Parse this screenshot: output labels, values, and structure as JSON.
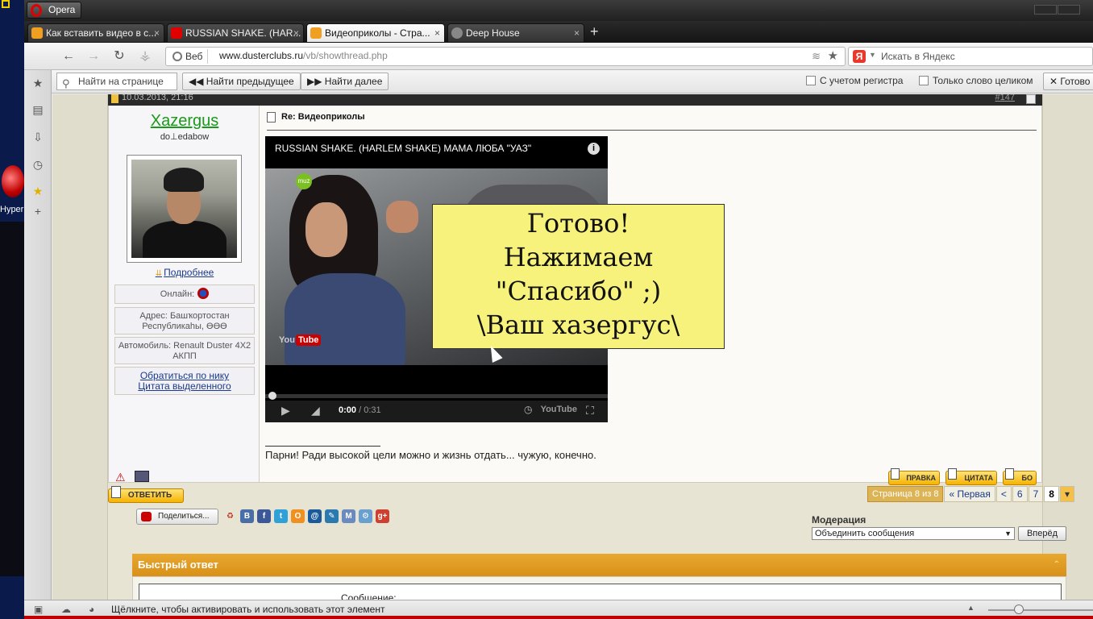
{
  "desktop": {
    "icon_label": "Hyper"
  },
  "browser": {
    "menu_button": "Opera",
    "tabs": [
      {
        "label": "Как вставить видео в с...",
        "active": false,
        "icon_color": "#f0a020"
      },
      {
        "label": "RUSSIAN SHAKE. (HAR...",
        "active": false,
        "icon_color": "#e00000"
      },
      {
        "label": "Видеоприколы - Стра...",
        "active": true,
        "icon_color": "#f0a020"
      },
      {
        "label": "Deep House",
        "active": false,
        "icon_color": "#888888"
      }
    ],
    "tab_close": "×",
    "new_tab": "+",
    "address": {
      "badge": "Веб",
      "domain": "www.dusterclubs.ru",
      "path": "/vb/showthread.php"
    },
    "search": {
      "logo": "Я",
      "placeholder": "Искать в Яндекс"
    },
    "find": {
      "input_placeholder": "Найти на странице",
      "prev": "Найти предыдущее",
      "next": "Найти далее",
      "case_label": "С учетом регистра",
      "whole_label": "Только слово целиком",
      "done": "Готово"
    },
    "status_text": "Щёлкните, чтобы активировать и использовать этот элемент",
    "zoom_level": 0.27
  },
  "post": {
    "date": "10.03.2013, 21:16",
    "number": "#147",
    "username": "Xazergus",
    "usertitle": "do⊥edabow",
    "more_link": "Подробнее",
    "online_label": "Онлайн:",
    "address": "Адрес: Башҡортостан Республикаһы, ӨӨӨ",
    "car": "Автомобиль: Renault Duster 4X2 АКПП",
    "link_nick": "Обратиться по нику",
    "link_quote": "Цитата выделенного",
    "title": "Re: Видеоприколы",
    "video": {
      "title": "RUSSIAN SHAKE. (HARLEM SHAKE) МАМА ЛЮБА \"УАЗ\"",
      "info_icon": "i",
      "time_current": "0:00",
      "time_total": " / 0:31",
      "youtube_mark": "You",
      "youtube_tube": "Tube",
      "muztv": "muz",
      "progress": 0.0
    },
    "signature": "Парни! Ради высокой цели можно и жизнь отдать... чужую, конечно.",
    "btn_edit": "ПРАВКА",
    "btn_quote": "ЦИТАТА",
    "btn_multi": "БО"
  },
  "thread": {
    "reply_button": "ОТВЕТИТЬ",
    "pager": {
      "label": "Страница 8 из 8",
      "first": "« Первая",
      "prev": "<",
      "p6": "6",
      "p7": "7",
      "p8": "8",
      "more": "▾"
    },
    "share_button": "Поделиться...",
    "social": [
      {
        "letter": "В",
        "color": "#4a6ea8"
      },
      {
        "letter": "f",
        "color": "#3b5998"
      },
      {
        "letter": "t",
        "color": "#2fa0d8"
      },
      {
        "letter": "О",
        "color": "#f09020"
      },
      {
        "letter": "@",
        "color": "#1a5a9a"
      },
      {
        "letter": "✎",
        "color": "#2a7ab0"
      },
      {
        "letter": "М",
        "color": "#6a8ac0"
      },
      {
        "letter": "⚙",
        "color": "#6aa0d0"
      },
      {
        "letter": "g+",
        "color": "#d04030"
      }
    ],
    "moderation_label": "Модерация",
    "moderation_option": "Объединить сообщения",
    "moderation_go": "Вперёд",
    "quick_reply_title": "Быстрый ответ",
    "message_label": "Сообщение:"
  },
  "overlay_note": {
    "line1": "Готово!",
    "line2": "Нажимаем",
    "line3": "\"Спасибо\" ;)",
    "line4": "\\Ваш хазергус\\"
  }
}
